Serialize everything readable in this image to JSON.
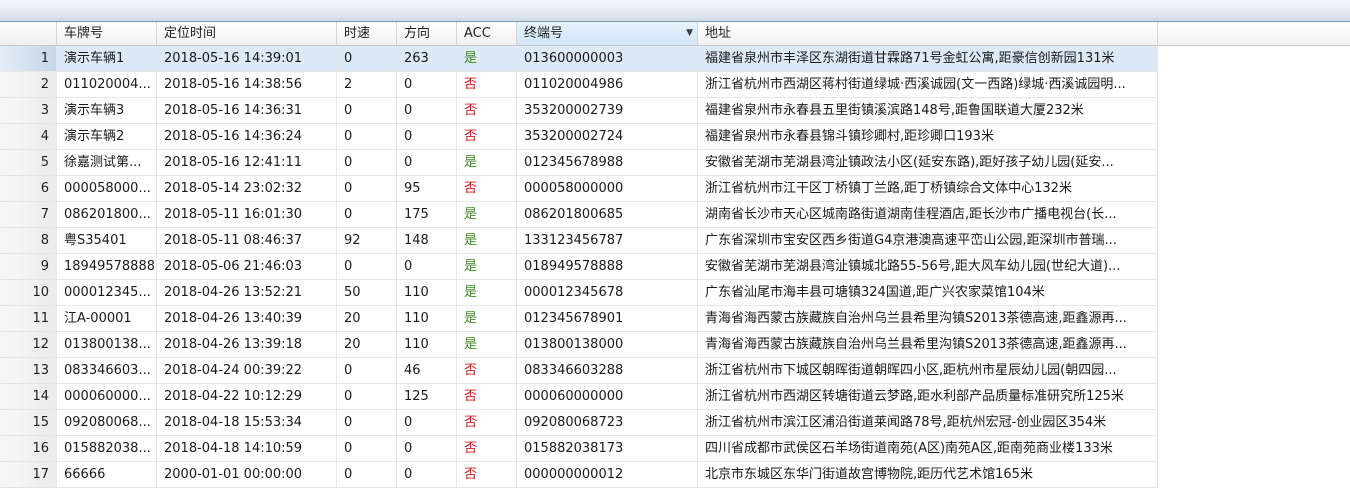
{
  "columns": {
    "plate": "车牌号",
    "time": "定位时间",
    "speed": "时速",
    "direction": "方向",
    "acc": "ACC",
    "terminal": "终端号",
    "address": "地址"
  },
  "acc_colors": {
    "yes": "#3a8a1e",
    "no": "#d01818"
  },
  "rows": [
    {
      "n": "1",
      "plate": "演示车辆1",
      "time": "2018-05-16 14:39:01",
      "speed": "0",
      "direction": "263",
      "acc": "是",
      "terminal": "013600000003",
      "address": "福建省泉州市丰泽区东湖街道甘霖路71号金虹公寓,距豪信创新园131米"
    },
    {
      "n": "2",
      "plate": "011020004...",
      "time": "2018-05-16 14:38:56",
      "speed": "2",
      "direction": "0",
      "acc": "否",
      "terminal": "011020004986",
      "address": "浙江省杭州市西湖区蒋村街道绿城·西溪诚园(文一西路)绿城·西溪诚园明..."
    },
    {
      "n": "3",
      "plate": "演示车辆3",
      "time": "2018-05-16 14:36:31",
      "speed": "0",
      "direction": "0",
      "acc": "否",
      "terminal": "353200002739",
      "address": "福建省泉州市永春县五里街镇溪滨路148号,距鲁国联道大厦232米"
    },
    {
      "n": "4",
      "plate": "演示车辆2",
      "time": "2018-05-16 14:36:24",
      "speed": "0",
      "direction": "0",
      "acc": "否",
      "terminal": "353200002724",
      "address": "福建省泉州市永春县锦斗镇珍卿村,距珍卿口193米"
    },
    {
      "n": "5",
      "plate": "徐嘉测试第...",
      "time": "2018-05-16 12:41:11",
      "speed": "0",
      "direction": "0",
      "acc": "是",
      "terminal": "012345678988",
      "address": "安徽省芜湖市芜湖县湾沚镇政法小区(延安东路),距好孩子幼儿园(延安..."
    },
    {
      "n": "6",
      "plate": "000058000...",
      "time": "2018-05-14 23:02:32",
      "speed": "0",
      "direction": "95",
      "acc": "否",
      "terminal": "000058000000",
      "address": "浙江省杭州市江干区丁桥镇丁兰路,距丁桥镇综合文体中心132米"
    },
    {
      "n": "7",
      "plate": "086201800...",
      "time": "2018-05-11 16:01:30",
      "speed": "0",
      "direction": "175",
      "acc": "是",
      "terminal": "086201800685",
      "address": "湖南省长沙市天心区城南路街道湖南佳程酒店,距长沙市广播电视台(长..."
    },
    {
      "n": "8",
      "plate": "粤S35401",
      "time": "2018-05-11 08:46:37",
      "speed": "92",
      "direction": "148",
      "acc": "是",
      "terminal": "133123456787",
      "address": "广东省深圳市宝安区西乡街道G4京港澳高速平峦山公园,距深圳市普瑞..."
    },
    {
      "n": "9",
      "plate": "18949578888",
      "time": "2018-05-06 21:46:03",
      "speed": "0",
      "direction": "0",
      "acc": "是",
      "terminal": "018949578888",
      "address": "安徽省芜湖市芜湖县湾沚镇城北路55-56号,距大风车幼儿园(世纪大道)..."
    },
    {
      "n": "10",
      "plate": "000012345...",
      "time": "2018-04-26 13:52:21",
      "speed": "50",
      "direction": "110",
      "acc": "是",
      "terminal": "000012345678",
      "address": "广东省汕尾市海丰县可塘镇324国道,距广兴农家菜馆104米"
    },
    {
      "n": "11",
      "plate": "江A-00001",
      "time": "2018-04-26 13:40:39",
      "speed": "20",
      "direction": "110",
      "acc": "是",
      "terminal": "012345678901",
      "address": "青海省海西蒙古族藏族自治州乌兰县希里沟镇S2013茶德高速,距鑫源再..."
    },
    {
      "n": "12",
      "plate": "013800138...",
      "time": "2018-04-26 13:39:18",
      "speed": "20",
      "direction": "110",
      "acc": "是",
      "terminal": "013800138000",
      "address": "青海省海西蒙古族藏族自治州乌兰县希里沟镇S2013茶德高速,距鑫源再..."
    },
    {
      "n": "13",
      "plate": "083346603...",
      "time": "2018-04-24 00:39:22",
      "speed": "0",
      "direction": "46",
      "acc": "否",
      "terminal": "083346603288",
      "address": "浙江省杭州市下城区朝晖街道朝晖四小区,距杭州市星辰幼儿园(朝四园..."
    },
    {
      "n": "14",
      "plate": "000060000...",
      "time": "2018-04-22 10:12:29",
      "speed": "0",
      "direction": "125",
      "acc": "否",
      "terminal": "000060000000",
      "address": "浙江省杭州市西湖区转塘街道云梦路,距水利部产品质量标准研究所125米"
    },
    {
      "n": "15",
      "plate": "092080068...",
      "time": "2018-04-18 15:53:34",
      "speed": "0",
      "direction": "0",
      "acc": "否",
      "terminal": "092080068723",
      "address": "浙江省杭州市滨江区浦沿街道莱闻路78号,距杭州宏冠-创业园区354米"
    },
    {
      "n": "16",
      "plate": "015882038...",
      "time": "2018-04-18 14:10:59",
      "speed": "0",
      "direction": "0",
      "acc": "否",
      "terminal": "015882038173",
      "address": "四川省成都市武侯区石羊场街道南苑(A区)南苑A区,距南苑商业楼133米"
    },
    {
      "n": "17",
      "plate": "66666",
      "time": "2000-01-01 00:00:00",
      "speed": "0",
      "direction": "0",
      "acc": "否",
      "terminal": "000000000012",
      "address": "北京市东城区东华门街道故宫博物院,距历代艺术馆165米"
    }
  ]
}
